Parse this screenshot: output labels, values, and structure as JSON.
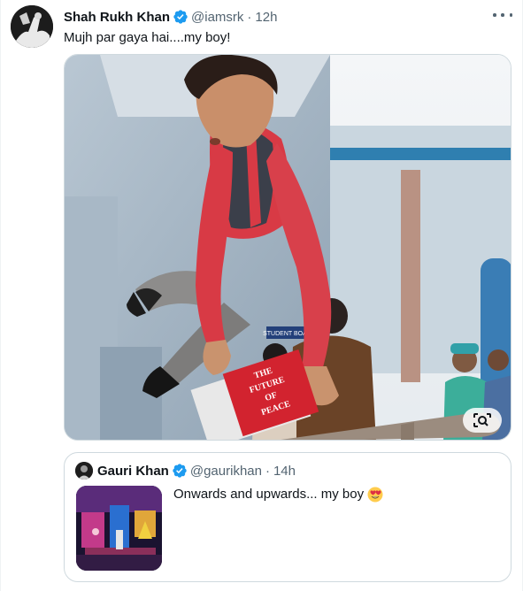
{
  "tweet": {
    "author": {
      "display_name": "Shah Rukh Khan",
      "handle": "@iamsrk",
      "verified": true
    },
    "separator": "·",
    "time": "12h",
    "text": "Mujh par gaya hai....my boy!",
    "media": {
      "book_text": [
        "THE",
        "FUTURE",
        "OF",
        "PEACE"
      ],
      "sign_text": "STUDENT BOARD"
    },
    "icons": {
      "more": "more-options-icon",
      "lens": "image-search-icon"
    }
  },
  "quoted_tweet": {
    "author": {
      "display_name": "Gauri Khan",
      "handle": "@gaurikhan",
      "verified": true
    },
    "separator": "·",
    "time": "14h",
    "text": "Onwards and upwards... my boy",
    "emoji": "heart-eyes-emoji"
  },
  "colors": {
    "verified_blue": "#1d9bf0",
    "text_primary": "#0f1419",
    "text_secondary": "#536471",
    "border": "#cfd9de"
  }
}
